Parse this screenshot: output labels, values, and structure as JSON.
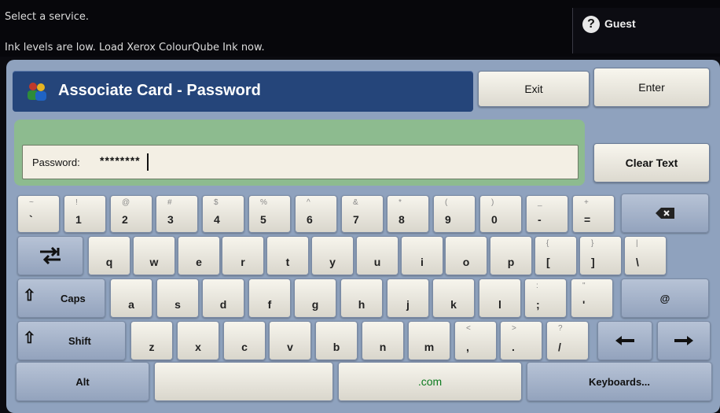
{
  "status": {
    "line1": "Select a service.",
    "line2": "Ink levels are low. Load Xerox ColourQube Ink now.",
    "user": "Guest",
    "user_icon": "user-question-icon"
  },
  "header": {
    "title": "Associate Card - Password",
    "exit_label": "Exit",
    "enter_label": "Enter",
    "clear_label": "Clear Text"
  },
  "password": {
    "label": "Password:",
    "value": "********"
  },
  "keyboard": {
    "row1": [
      {
        "shift": "~",
        "main": "`"
      },
      {
        "shift": "!",
        "main": "1"
      },
      {
        "shift": "@",
        "main": "2"
      },
      {
        "shift": "#",
        "main": "3"
      },
      {
        "shift": "$",
        "main": "4"
      },
      {
        "shift": "%",
        "main": "5"
      },
      {
        "shift": "^",
        "main": "6"
      },
      {
        "shift": "&",
        "main": "7"
      },
      {
        "shift": "*",
        "main": "8"
      },
      {
        "shift": "(",
        "main": "9"
      },
      {
        "shift": ")",
        "main": "0"
      },
      {
        "shift": "_",
        "main": "-"
      },
      {
        "shift": "+",
        "main": "="
      }
    ],
    "row2": [
      {
        "main": "q"
      },
      {
        "main": "w"
      },
      {
        "main": "e"
      },
      {
        "main": "r"
      },
      {
        "main": "t"
      },
      {
        "main": "y"
      },
      {
        "main": "u"
      },
      {
        "main": "i"
      },
      {
        "main": "o"
      },
      {
        "main": "p"
      },
      {
        "shift": "{",
        "main": "["
      },
      {
        "shift": "}",
        "main": "]"
      },
      {
        "shift": "|",
        "main": "\\"
      }
    ],
    "row3": [
      {
        "main": "a"
      },
      {
        "main": "s"
      },
      {
        "main": "d"
      },
      {
        "main": "f"
      },
      {
        "main": "g"
      },
      {
        "main": "h"
      },
      {
        "main": "j"
      },
      {
        "main": "k"
      },
      {
        "main": "l"
      },
      {
        "shift": ":",
        "main": ";"
      },
      {
        "shift": "\"",
        "main": "'"
      }
    ],
    "row4": [
      {
        "main": "z"
      },
      {
        "main": "x"
      },
      {
        "main": "c"
      },
      {
        "main": "v"
      },
      {
        "main": "b"
      },
      {
        "main": "n"
      },
      {
        "main": "m"
      },
      {
        "shift": "<",
        "main": ","
      },
      {
        "shift": ">",
        "main": "."
      },
      {
        "shift": "?",
        "main": "/"
      }
    ],
    "caps_label": "Caps",
    "shift_label": "Shift",
    "alt_label": "Alt",
    "at_label": "@",
    "com_label": ".com",
    "keyboards_label": "Keyboards..."
  }
}
